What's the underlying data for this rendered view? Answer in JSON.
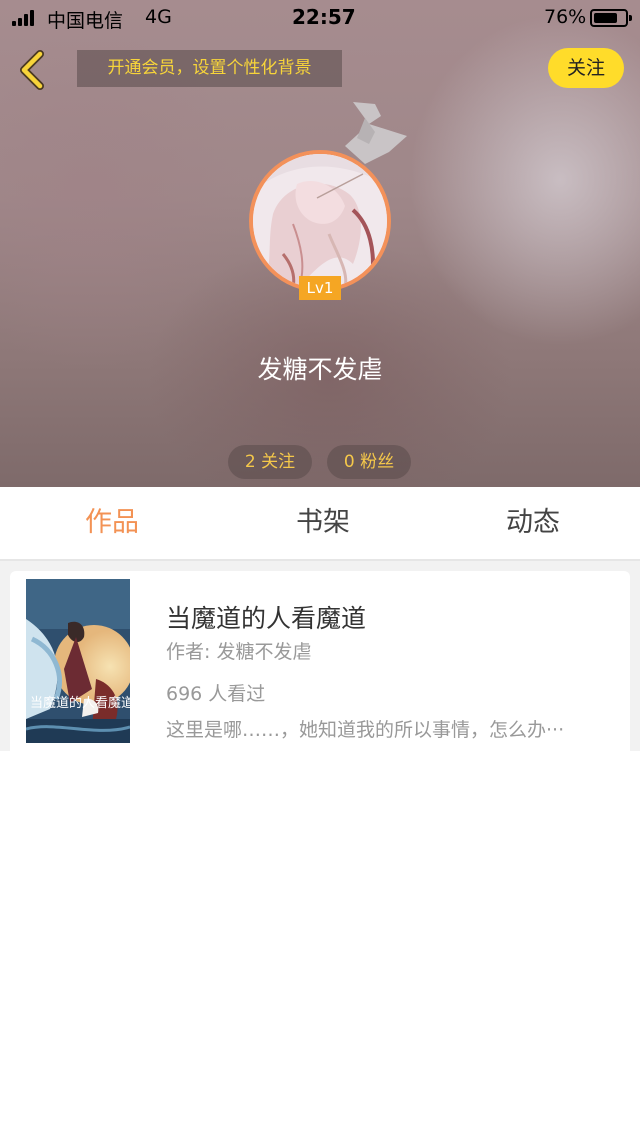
{
  "status_bar": {
    "carrier": "中国电信",
    "network": "4G",
    "time": "22:57",
    "battery_percent": "76%",
    "battery_level": 0.76
  },
  "header": {
    "back_icon": "chevron-left-icon",
    "vip_banner": "开通会员，设置个性化背景",
    "follow_label": "关注"
  },
  "profile": {
    "level": "Lv1",
    "nickname": "发糖不发虐",
    "following": "2 关注",
    "fans": "0 粉丝"
  },
  "tabs": [
    {
      "label": "作品",
      "active": true
    },
    {
      "label": "书架",
      "active": false
    },
    {
      "label": "动态",
      "active": false
    }
  ],
  "works": [
    {
      "title": "当魔道的人看魔道",
      "author": "作者: 发糖不发虐",
      "views": "696 人看过",
      "description": "这里是哪……，她知道我的所以事情，怎么办···",
      "cover_text": "当魔道的人看魔道"
    }
  ],
  "colors": {
    "accent": "#f39254",
    "follow_button": "#ffdc2a",
    "banner_text": "#f7d43a",
    "level_badge": "#f5a623"
  }
}
